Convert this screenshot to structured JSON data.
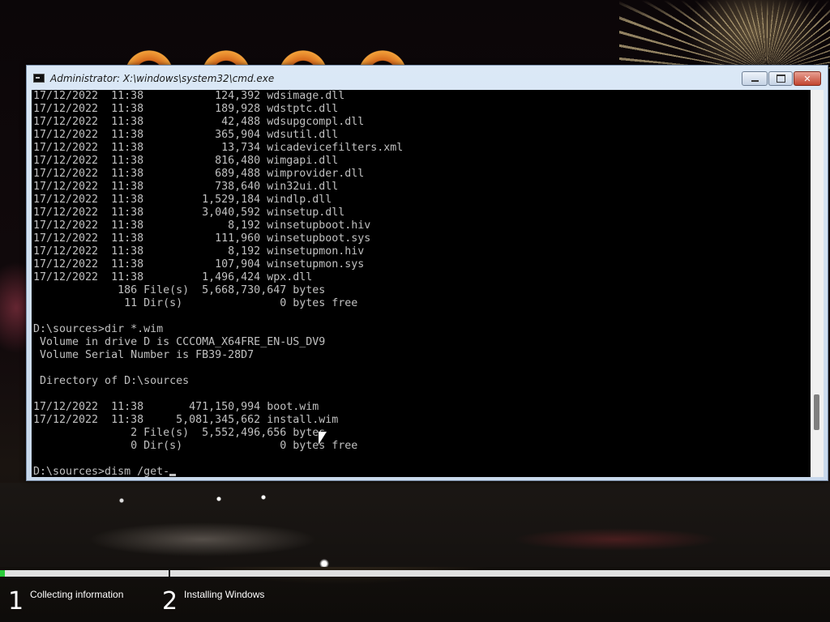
{
  "window": {
    "title": "Administrator: X:\\windows\\system32\\cmd.exe",
    "minimize_label": "",
    "maximize_label": "",
    "close_label": "✕"
  },
  "console": {
    "lines": [
      "17/12/2022  11:38           124,392 wdsimage.dll",
      "17/12/2022  11:38           189,928 wdstptc.dll",
      "17/12/2022  11:38            42,488 wdsupgcompl.dll",
      "17/12/2022  11:38           365,904 wdsutil.dll",
      "17/12/2022  11:38            13,734 wicadevicefilters.xml",
      "17/12/2022  11:38           816,480 wimgapi.dll",
      "17/12/2022  11:38           689,488 wimprovider.dll",
      "17/12/2022  11:38           738,640 win32ui.dll",
      "17/12/2022  11:38         1,529,184 windlp.dll",
      "17/12/2022  11:38         3,040,592 winsetup.dll",
      "17/12/2022  11:38             8,192 winsetupboot.hiv",
      "17/12/2022  11:38           111,960 winsetupboot.sys",
      "17/12/2022  11:38             8,192 winsetupmon.hiv",
      "17/12/2022  11:38           107,904 winsetupmon.sys",
      "17/12/2022  11:38         1,496,424 wpx.dll",
      "             186 File(s)  5,668,730,647 bytes",
      "              11 Dir(s)               0 bytes free",
      "",
      "D:\\sources>dir *.wim",
      " Volume in drive D is CCCOMA_X64FRE_EN-US_DV9",
      " Volume Serial Number is FB39-28D7",
      "",
      " Directory of D:\\sources",
      "",
      "17/12/2022  11:38       471,150,994 boot.wim",
      "17/12/2022  11:38     5,081,345,662 install.wim",
      "               2 File(s)  5,552,496,656 bytes",
      "               0 Dir(s)               0 bytes free",
      ""
    ],
    "prompt": "D:\\sources>dism /get-"
  },
  "setup": {
    "progress_fraction": 0.006,
    "steps": [
      {
        "number": "1",
        "label": "Collecting information"
      },
      {
        "number": "2",
        "label": "Installing Windows"
      }
    ]
  },
  "colors": {
    "console_bg": "#000000",
    "console_text": "#c0c0c0",
    "progress_fill": "#2bcc3a",
    "close_button": "#c24530"
  }
}
